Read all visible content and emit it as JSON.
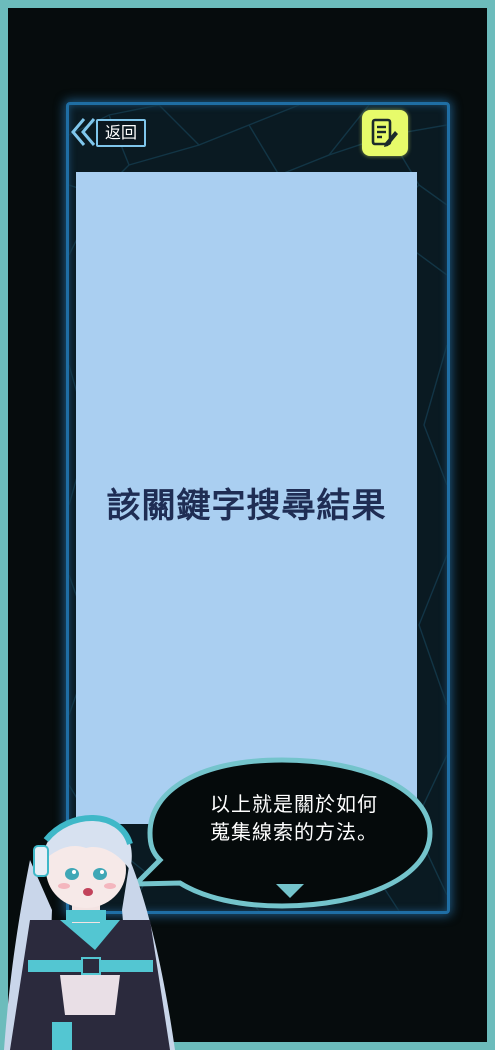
{
  "header": {
    "back_label": "返回"
  },
  "content": {
    "title": "該關鍵字搜尋結果"
  },
  "dialog": {
    "text": "以上就是關於如何蒐集線索的方法。"
  },
  "icons": {
    "back": "double-chevron-left-icon",
    "notes": "notepad-pencil-icon",
    "next": "triangle-down-icon"
  },
  "colors": {
    "outer_border": "#6cbcbc",
    "background": "#060c0d",
    "panel_border": "#1f6ea4",
    "card": "#aacff1",
    "title_text": "#1f2d54",
    "notes_button": "#e7fb6a",
    "bubble_border": "#74c4cc"
  }
}
